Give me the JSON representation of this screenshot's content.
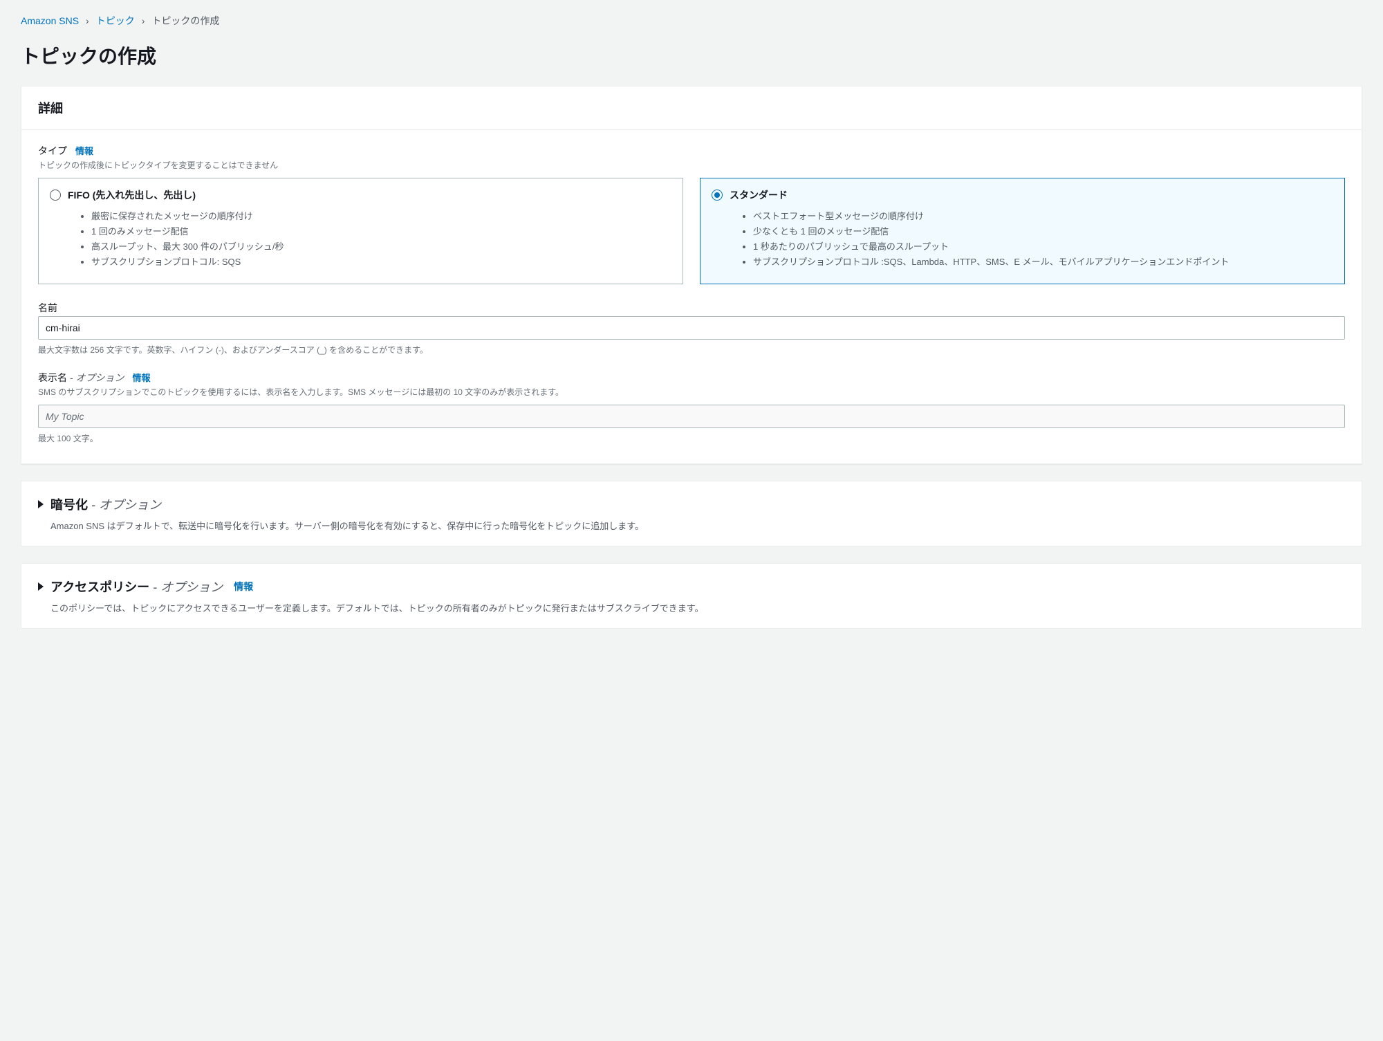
{
  "breadcrumb": {
    "service": "Amazon SNS",
    "topics": "トピック",
    "current": "トピックの作成"
  },
  "page_title": "トピックの作成",
  "details": {
    "heading": "詳細",
    "type": {
      "label": "タイプ",
      "info": "情報",
      "hint": "トピックの作成後にトピックタイプを変更することはできません",
      "fifo": {
        "title": "FIFO (先入れ先出し、先出し)",
        "bullets": [
          "厳密に保存されたメッセージの順序付け",
          "1 回のみメッセージ配信",
          "高スループット、最大 300 件のパブリッシュ/秒",
          "サブスクリプションプロトコル: SQS"
        ]
      },
      "standard": {
        "title": "スタンダード",
        "bullets": [
          "ベストエフォート型メッセージの順序付け",
          "少なくとも 1 回のメッセージ配信",
          "1 秒あたりのパブリッシュで最高のスループット",
          "サブスクリプションプロトコル :SQS、Lambda、HTTP、SMS、E メール、モバイルアプリケーションエンドポイント"
        ]
      },
      "selected": "standard"
    },
    "name": {
      "label": "名前",
      "value": "cm-hirai",
      "help": "最大文字数は 256 文字です。英数字、ハイフン (-)、およびアンダースコア (_) を含めることができます。"
    },
    "display_name": {
      "label": "表示名",
      "optional": " - オプション",
      "info": "情報",
      "hint": "SMS のサブスクリプションでこのトピックを使用するには、表示名を入力します。SMS メッセージには最初の 10 文字のみが表示されます。",
      "placeholder": "My Topic",
      "value": "",
      "help": "最大 100 文字。"
    }
  },
  "encryption": {
    "title": "暗号化",
    "optional": " - オプション",
    "desc": "Amazon SNS はデフォルトで、転送中に暗号化を行います。サーバー側の暗号化を有効にすると、保存中に行った暗号化をトピックに追加します。"
  },
  "access_policy": {
    "title": "アクセスポリシー",
    "optional": " - オプション",
    "info": "情報",
    "desc": "このポリシーでは、トピックにアクセスできるユーザーを定義します。デフォルトでは、トピックの所有者のみがトピックに発行またはサブスクライブできます。"
  }
}
